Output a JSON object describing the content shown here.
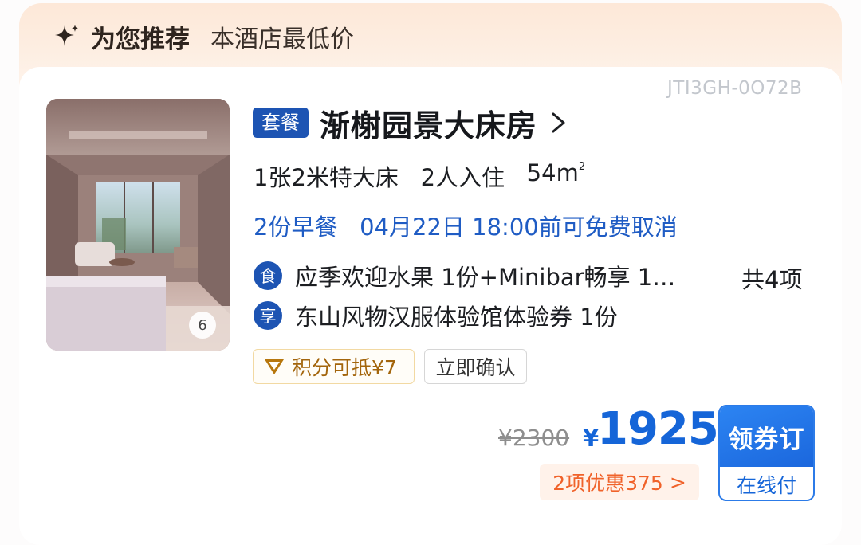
{
  "header": {
    "title": "为您推荐",
    "subtitle": "本酒店最低价",
    "icon": "sparkle-icon"
  },
  "room": {
    "code": "JTI3GH-0O72B",
    "photo_count": "6",
    "package_badge": "套餐",
    "name": "渐榭园景大床房",
    "bed": "1张2米特大床",
    "occupancy": "2人入住",
    "area": "54m",
    "area_sup": "2",
    "breakfast": "2份早餐",
    "cancel_date": "04月22日",
    "cancel_policy": "18:00前可免费取消",
    "perks": [
      {
        "icon": "食",
        "text": "应季欢迎水果 1份+Minibar畅享 1…"
      },
      {
        "icon": "享",
        "text": "东山风物汉服体验馆体验券 1份"
      }
    ],
    "perks_total": "共4项",
    "tags": {
      "points": "积分可抵¥7",
      "instant": "立即确认"
    }
  },
  "price": {
    "original": "¥2300",
    "currency": "¥",
    "current": "1925",
    "discount": "2项优惠375",
    "discount_arrow": ">"
  },
  "booking": {
    "main_label": "领券订",
    "sub_label": "在线付"
  },
  "colors": {
    "accent_blue": "#1d54b3",
    "price_blue": "#1565d8",
    "discount_orange": "#f0622a",
    "points_gold": "#a3650c"
  }
}
